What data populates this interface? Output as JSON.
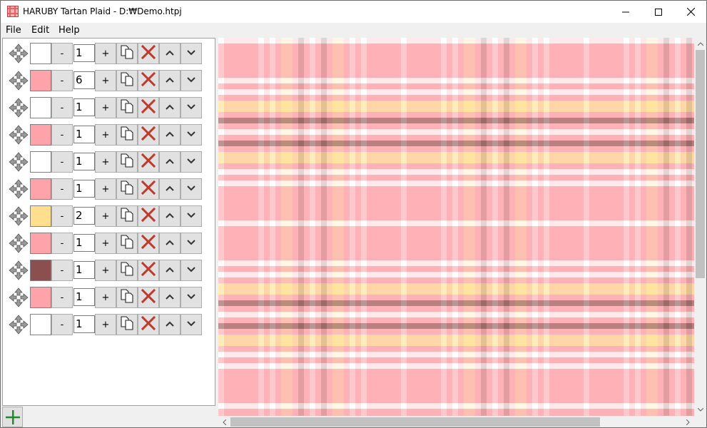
{
  "window": {
    "title": "HARUBY Tartan Plaid - D:₩Demo.htpj",
    "controls": {
      "minimize": "minimize",
      "maximize": "maximize",
      "close": "close"
    }
  },
  "menu": [
    {
      "label": "File"
    },
    {
      "label": "Edit"
    },
    {
      "label": "Help"
    }
  ],
  "stripes": [
    {
      "color": "#ffffff",
      "count": "1"
    },
    {
      "color": "#fea3aa",
      "count": "6"
    },
    {
      "color": "#ffffff",
      "count": "1"
    },
    {
      "color": "#fea3aa",
      "count": "1"
    },
    {
      "color": "#ffffff",
      "count": "1"
    },
    {
      "color": "#fea3aa",
      "count": "1"
    },
    {
      "color": "#ffdf8e",
      "count": "2"
    },
    {
      "color": "#fea3aa",
      "count": "1"
    },
    {
      "color": "#8b4f4f",
      "count": "1"
    },
    {
      "color": "#fea3aa",
      "count": "1"
    },
    {
      "color": "#ffffff",
      "count": "1"
    }
  ],
  "row_buttons": {
    "minus": "-",
    "plus": "+"
  },
  "icons": {
    "move": "move-arrows-icon",
    "copy": "copy-icon",
    "delete": "delete-x-icon",
    "up": "chevron-up-icon",
    "down": "chevron-down-icon",
    "add": "plus-icon"
  },
  "colors": {
    "delete_red": "#c0392b",
    "add_green": "#1e8c2e"
  }
}
